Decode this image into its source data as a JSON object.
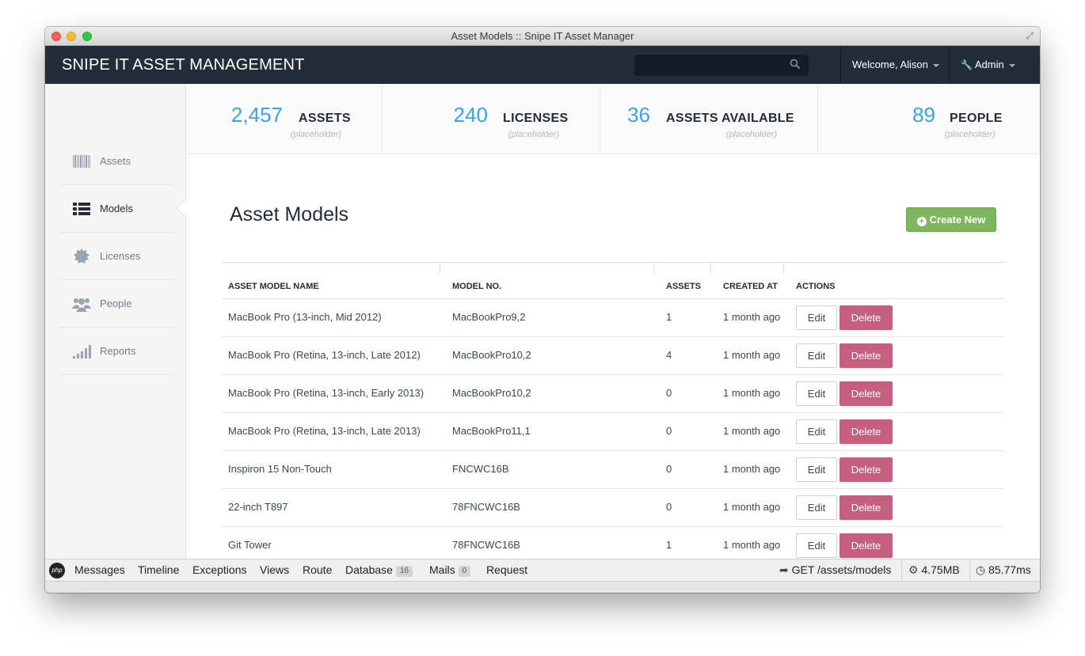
{
  "window": {
    "title": "Asset Models :: Snipe IT Asset Manager"
  },
  "topnav": {
    "brand": "SNIPE IT ASSET MANAGEMENT",
    "search_placeholder": "",
    "welcome": "Welcome, Alison",
    "admin": "Admin"
  },
  "sidebar": {
    "items": [
      {
        "label": "Assets",
        "icon": "barcode-icon"
      },
      {
        "label": "Models",
        "icon": "list-icon"
      },
      {
        "label": "Licenses",
        "icon": "certificate-icon"
      },
      {
        "label": "People",
        "icon": "users-icon"
      },
      {
        "label": "Reports",
        "icon": "signal-icon"
      }
    ],
    "active": "Models"
  },
  "stats": [
    {
      "value": "2,457",
      "label": "ASSETS",
      "sub": "(placeholder)"
    },
    {
      "value": "240",
      "label": "LICENSES",
      "sub": "(placeholder)"
    },
    {
      "value": "36",
      "label": "ASSETS AVAILABLE",
      "sub": "(placeholder)"
    },
    {
      "value": "89",
      "label": "PEOPLE",
      "sub": "(placeholder)"
    }
  ],
  "page": {
    "title": "Asset Models",
    "create_label": "Create New"
  },
  "table": {
    "headers": [
      "ASSET MODEL NAME",
      "MODEL NO.",
      "ASSETS",
      "CREATED AT",
      "ACTIONS"
    ],
    "edit_label": "Edit",
    "delete_label": "Delete",
    "rows": [
      {
        "name": "MacBook Pro (13-inch, Mid 2012)",
        "model_no": "MacBookPro9,2",
        "assets": "1",
        "created": "1 month ago"
      },
      {
        "name": "MacBook Pro (Retina, 13-inch, Late 2012)",
        "model_no": "MacBookPro10,2",
        "assets": "4",
        "created": "1 month ago"
      },
      {
        "name": "MacBook Pro (Retina, 13-inch, Early 2013)",
        "model_no": "MacBookPro10,2",
        "assets": "0",
        "created": "1 month ago"
      },
      {
        "name": "MacBook Pro (Retina, 13-inch, Late 2013)",
        "model_no": "MacBookPro11,1",
        "assets": "0",
        "created": "1 month ago"
      },
      {
        "name": "Inspiron 15 Non-Touch",
        "model_no": "FNCWC16B",
        "assets": "0",
        "created": "1 month ago"
      },
      {
        "name": "22-inch T897",
        "model_no": "78FNCWC16B",
        "assets": "0",
        "created": "1 month ago"
      },
      {
        "name": "Git Tower",
        "model_no": "78FNCWC16B",
        "assets": "1",
        "created": "1 month ago"
      }
    ]
  },
  "debugbar": {
    "logo": "php",
    "tabs": [
      {
        "label": "Messages"
      },
      {
        "label": "Timeline"
      },
      {
        "label": "Exceptions"
      },
      {
        "label": "Views"
      },
      {
        "label": "Route"
      },
      {
        "label": "Database",
        "badge": "16"
      },
      {
        "label": "Mails",
        "badge": "0"
      },
      {
        "label": "Request"
      }
    ],
    "route": "GET /assets/models",
    "memory": "4.75MB",
    "time": "85.77ms"
  },
  "colors": {
    "navbar": "#232d38",
    "accent_blue": "#3aa3e3",
    "create_green": "#7eb55f",
    "delete_pink": "#c45f7f"
  }
}
